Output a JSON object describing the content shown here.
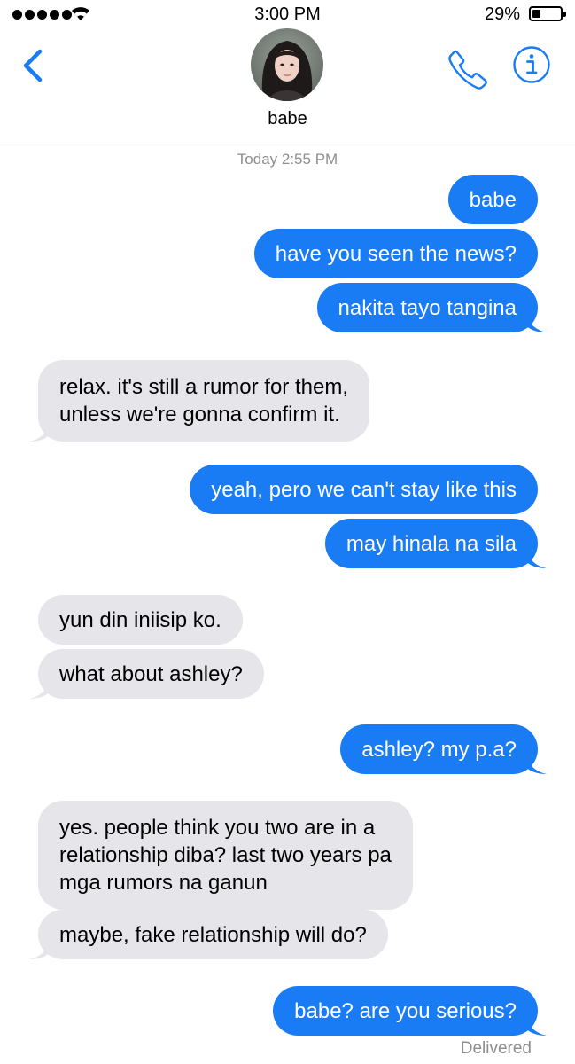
{
  "status_bar": {
    "time": "3:00 PM",
    "battery_percent": "29%",
    "battery_level": 0.29,
    "signal_bars": 5
  },
  "header": {
    "contact_name": "babe",
    "icons": [
      "back-chevron-icon",
      "phone-icon",
      "info-icon"
    ]
  },
  "timestamp": "Today 2:55 PM",
  "messages": [
    {
      "from": "me",
      "text": "babe"
    },
    {
      "from": "me",
      "text": "have you seen the news?"
    },
    {
      "from": "me",
      "text": "nakita tayo tangina"
    },
    {
      "from": "them",
      "lines": [
        "relax. it's still a rumor for them,",
        "unless we're gonna confirm it."
      ]
    },
    {
      "from": "me",
      "text": "yeah, pero we can't stay like this"
    },
    {
      "from": "me",
      "text": "may hinala na sila"
    },
    {
      "from": "them",
      "text": "yun din iniisip ko."
    },
    {
      "from": "them",
      "text": "what about ashley?"
    },
    {
      "from": "me",
      "text": "ashley? my p.a?"
    },
    {
      "from": "them",
      "lines": [
        "yes. people think you two are in a",
        "relationship diba? last two years pa",
        "mga rumors na ganun"
      ]
    },
    {
      "from": "them",
      "text": "maybe, fake relationship will do?"
    },
    {
      "from": "me",
      "text": "babe? are you serious?"
    }
  ],
  "delivery_status": "Delivered",
  "colors": {
    "accent": "#1a7cf5",
    "incoming_bubble": "#e5e5ea",
    "secondary_text": "#8e8e93"
  }
}
